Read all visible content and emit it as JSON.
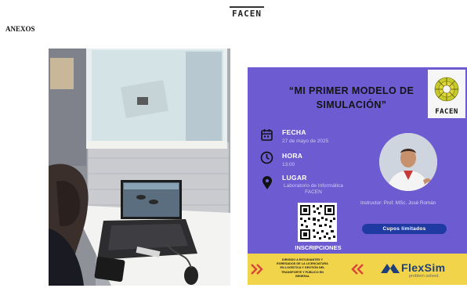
{
  "header": {
    "logo_text": "FACEN",
    "section_label": "ANEXOS"
  },
  "flyer": {
    "title_line1": "“MI PRIMER MODELO DE",
    "title_line2": "SIMULACIÓN”",
    "logo_text": "FACEN",
    "fecha_label": "FECHA",
    "fecha_value": "27 de mayo de 2025",
    "hora_label": "HORA",
    "hora_value": "13:00",
    "lugar_label": "LUGAR",
    "lugar_line1": "Laboratorio de Informática",
    "lugar_line2": "FACEN",
    "instructor": "Instructor: Prof. MSc. José Román",
    "inscripciones": "INSCRIPCIONES",
    "cupos": "Cupos limitados",
    "banner_line1": "DIRIGIDO A ESTUDIANTES Y",
    "banner_line2": "EGRESADOS DE LA LICENCIATURA",
    "banner_line3": "EN LOGÍSTICA Y GESTIÓN DEL",
    "banner_line4": "TRANSPORTE Y PÚBLICO EN",
    "banner_line5": "GENERAL",
    "flexsim_name": "FlexSim",
    "flexsim_tagline": "problem solved."
  },
  "colors": {
    "flyer_bg": "#6d5bd1",
    "banner_bg": "#f2d44a",
    "cupos_bg": "#1f3aa3",
    "accent_red": "#d9453a"
  },
  "icons": [
    "calendar-icon",
    "clock-icon",
    "location-pin-icon",
    "qr-code",
    "facen-emblem-icon",
    "flexsim-logo-icon"
  ]
}
